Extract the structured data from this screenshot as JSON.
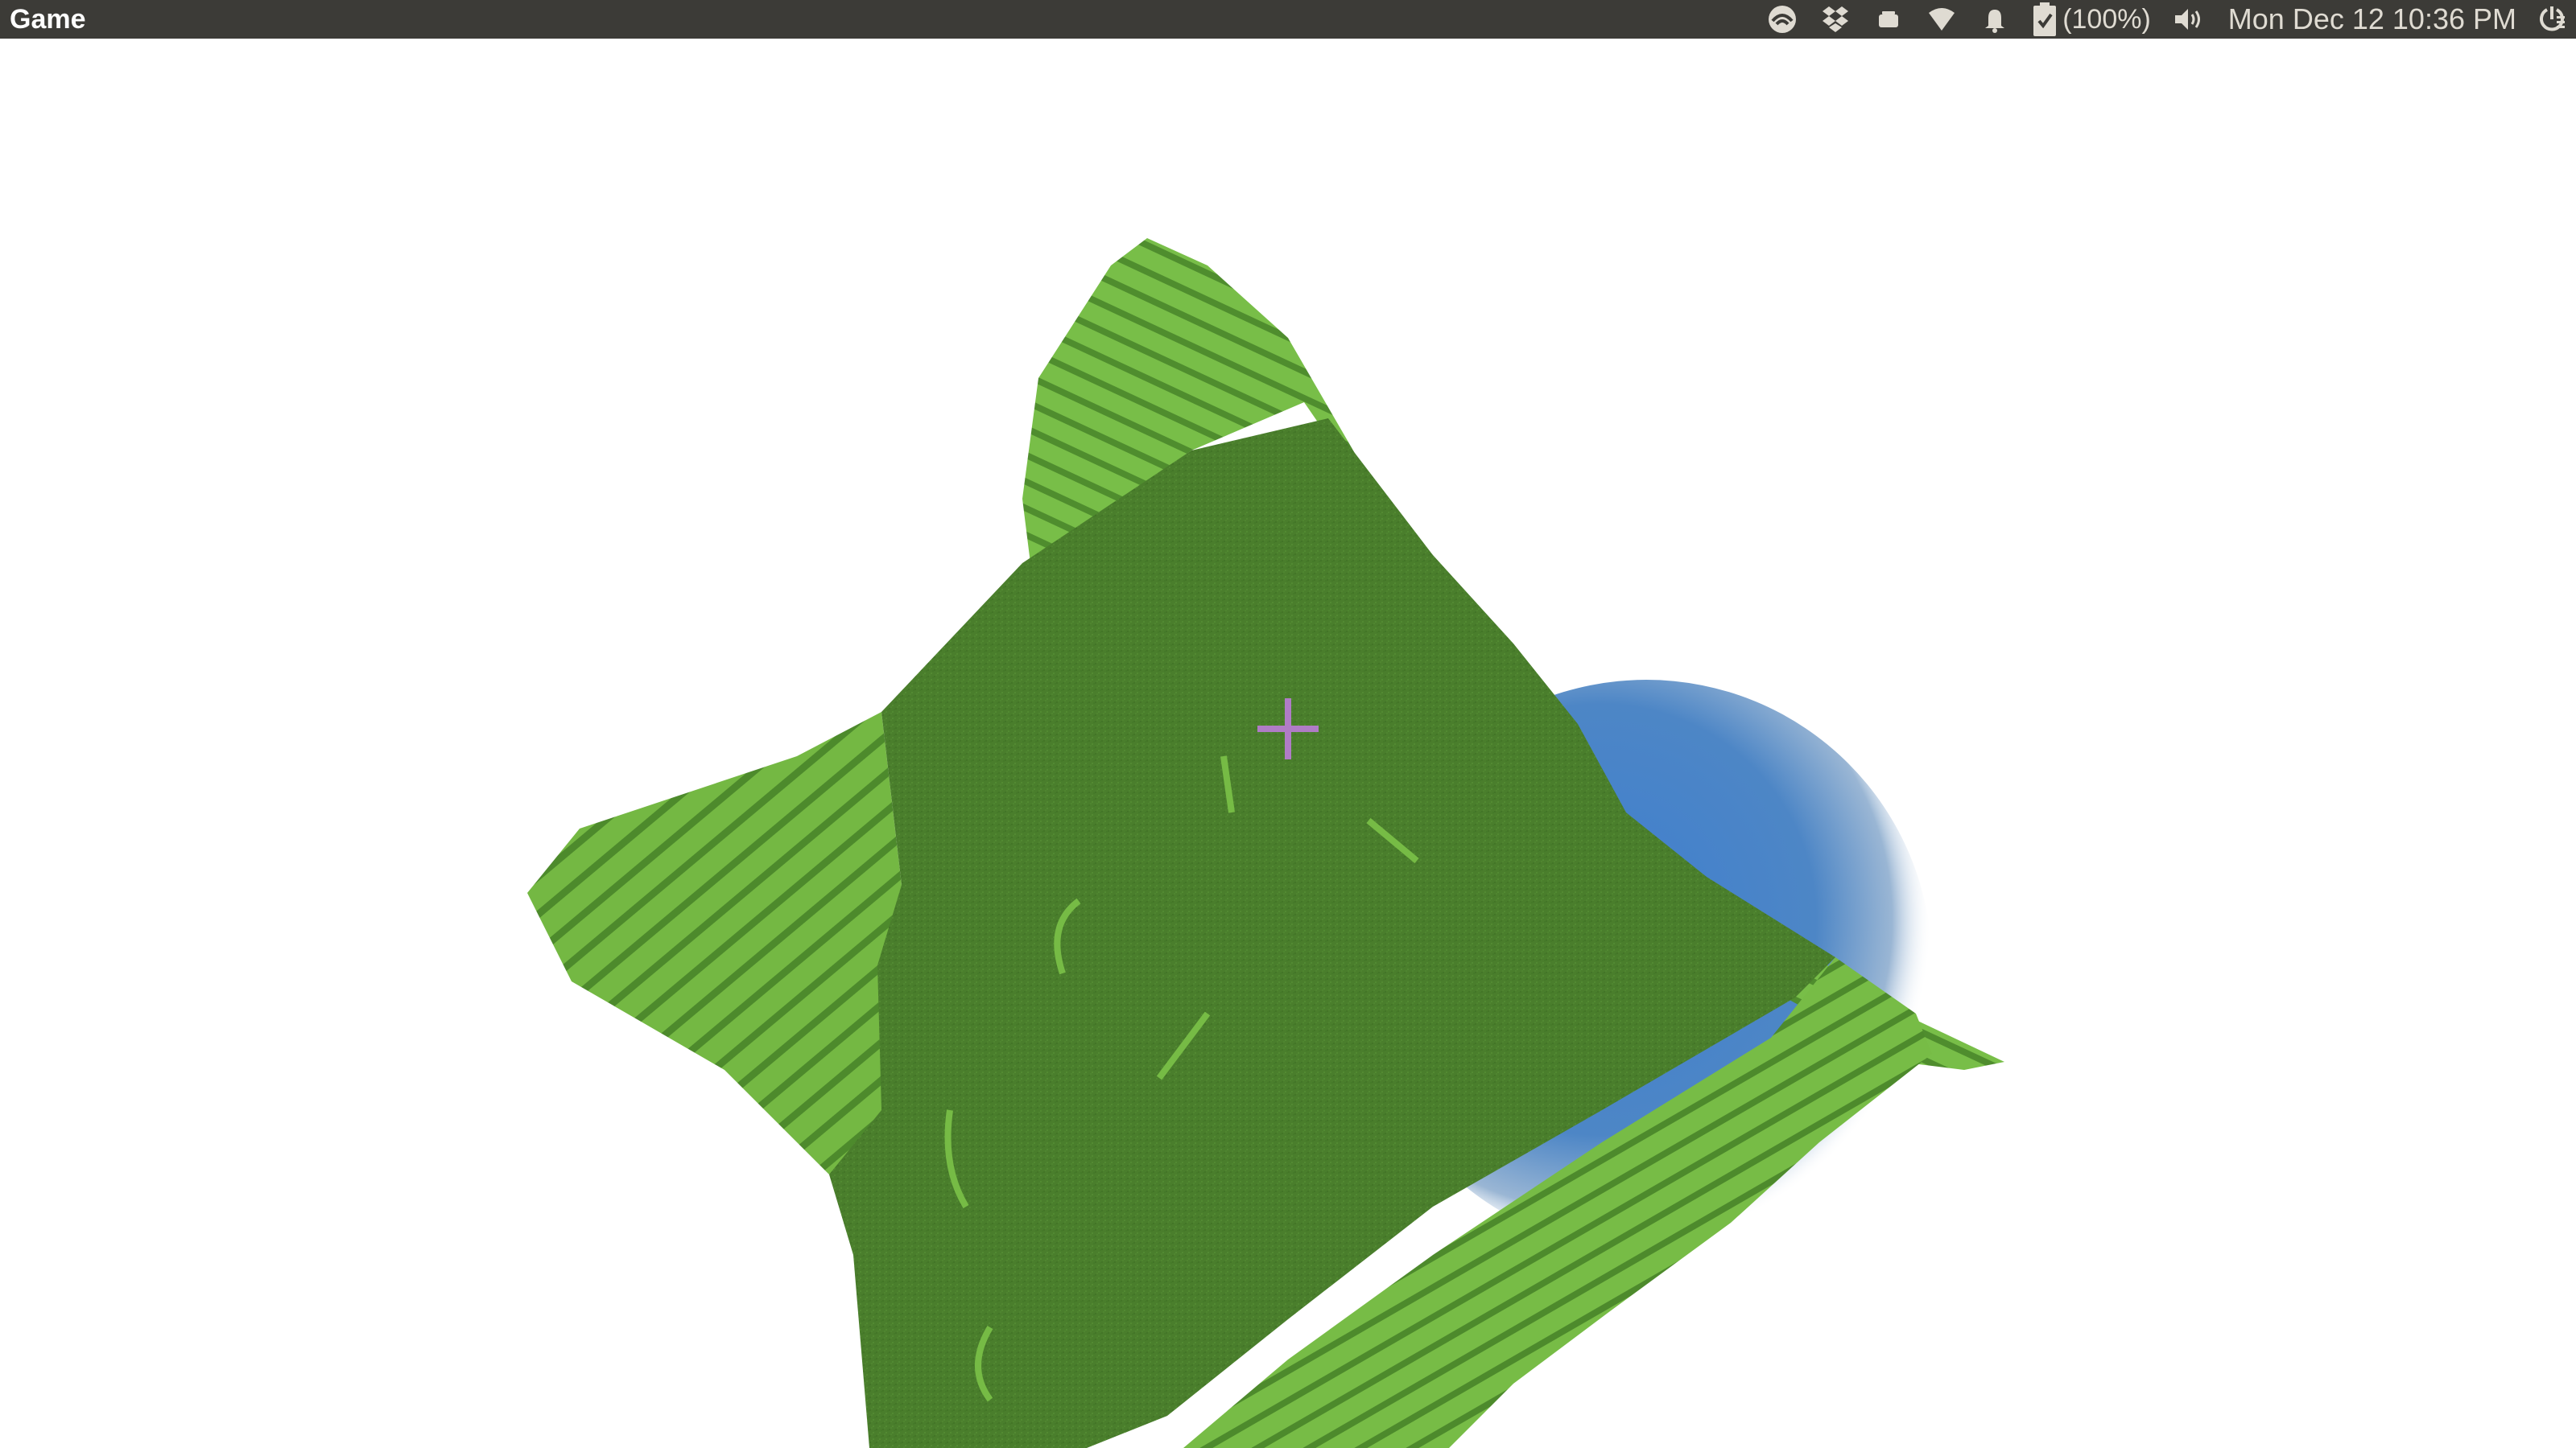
{
  "topbar": {
    "app_title": "Game",
    "battery_text": "(100%)",
    "clock": "Mon Dec 12 10:36 PM",
    "indicators": [
      "wifi-cloud-icon",
      "dropbox-icon",
      "keyboard-icon",
      "wifi-icon",
      "notification-bell-icon",
      "battery-icon",
      "volume-icon",
      "session-power-icon"
    ]
  },
  "scene": {
    "terrain_color_dark": "#4a7e2c",
    "terrain_color_light": "#76bb45",
    "sky_sphere_color": "#4a86c8",
    "crosshair_color": "#b07cc6"
  }
}
